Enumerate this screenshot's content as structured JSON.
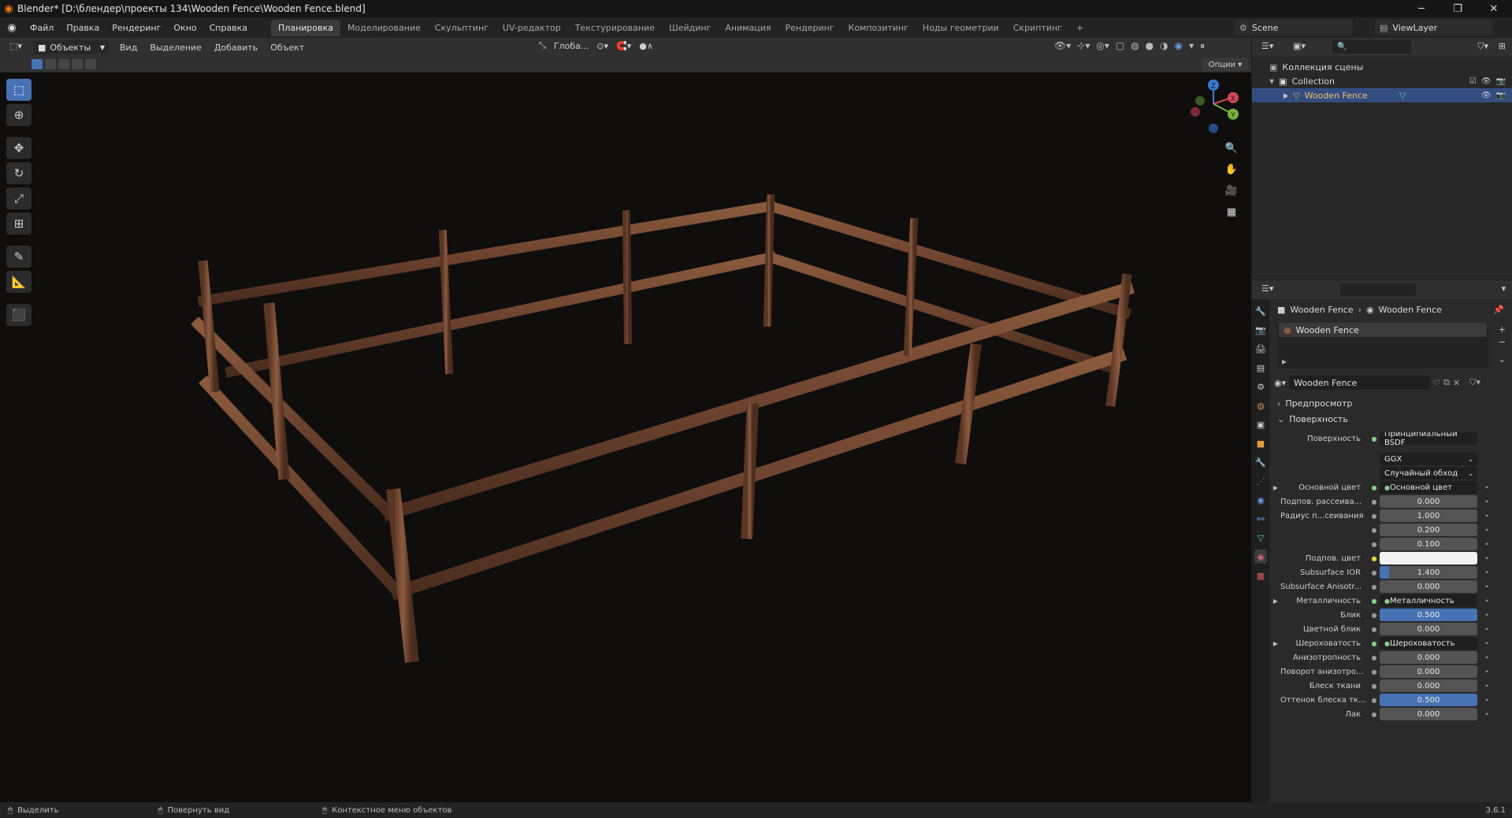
{
  "window": {
    "title": "Blender* [D:\\блендер\\проекты 134\\Wooden Fence\\Wooden Fence.blend]",
    "controls": [
      "─",
      "❐",
      "✕"
    ]
  },
  "menu": [
    "Файл",
    "Правка",
    "Рендеринг",
    "Окно",
    "Справка"
  ],
  "workspaces": [
    "Планировка",
    "Моделирование",
    "Скульптинг",
    "UV-редактор",
    "Текстурирование",
    "Шейдинг",
    "Анимация",
    "Рендеринг",
    "Композитинг",
    "Ноды геометрии",
    "Скриптинг"
  ],
  "active_workspace": "Планировка",
  "scene": {
    "scene_name": "Scene",
    "view_layer": "ViewLayer"
  },
  "viewport_header": {
    "mode": "Объекты",
    "menus": [
      "Вид",
      "Выделение",
      "Добавить",
      "Объект"
    ],
    "transform_orientation": "Глоба...",
    "options": "Опции"
  },
  "outliner": {
    "root": "Коллекция сцены",
    "collection": "Collection",
    "object": "Wooden Fence"
  },
  "properties": {
    "breadcrumb_object": "Wooden Fence",
    "breadcrumb_material": "Wooden Fence",
    "slot": "Wooden Fence",
    "material_name": "Wooden Fence",
    "panel_preview": "Предпросмотр",
    "panel_surface": "Поверхность",
    "surface_label": "Поверхность",
    "surface_value": "Принципиальный BSDF",
    "distribution": "GGX",
    "subsurface_method": "Случайный обход",
    "rows": [
      {
        "label": "Основной цвет",
        "value": "Основной цвет",
        "kind": "link"
      },
      {
        "label": "Подпов. рассеива...",
        "value": "0.000",
        "kind": "num"
      },
      {
        "label": "Радиус п...сеивания",
        "value": "1.000",
        "kind": "num"
      },
      {
        "label": "",
        "value": "0.200",
        "kind": "num"
      },
      {
        "label": "",
        "value": "0.100",
        "kind": "num"
      },
      {
        "label": "Подпов. цвет",
        "value": "",
        "kind": "color"
      },
      {
        "label": "Subsurface IOR",
        "value": "1.400",
        "kind": "num",
        "fill": 0.1
      },
      {
        "label": "Subsurface Anisotr...",
        "value": "0.000",
        "kind": "num"
      },
      {
        "label": "Металличность",
        "value": "Металличность",
        "kind": "link"
      },
      {
        "label": "Блик",
        "value": "0.500",
        "kind": "num",
        "fill": 1.0
      },
      {
        "label": "Цветной блик",
        "value": "0.000",
        "kind": "num"
      },
      {
        "label": "Шероховатость",
        "value": "Шероховатость",
        "kind": "link"
      },
      {
        "label": "Анизотропность",
        "value": "0.000",
        "kind": "num"
      },
      {
        "label": "Поворот анизотро...",
        "value": "0.000",
        "kind": "num"
      },
      {
        "label": "Блеск ткани",
        "value": "0.000",
        "kind": "num"
      },
      {
        "label": "Оттенок блеска тк...",
        "value": "0.500",
        "kind": "num",
        "fill": 1.0
      },
      {
        "label": "Лак",
        "value": "0.000",
        "kind": "num"
      }
    ]
  },
  "statusbar": {
    "select": "Выделить",
    "rotate": "Повернуть вид",
    "context": "Контекстное меню объектов",
    "version": "3.6.1"
  },
  "gizmo": {
    "x": "X",
    "y": "Y",
    "z": "Z"
  }
}
